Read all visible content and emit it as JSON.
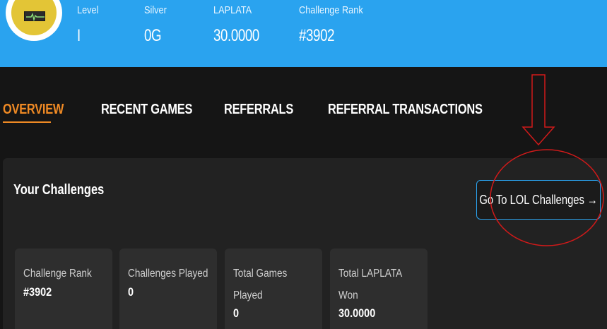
{
  "profile": {
    "avatar_icon": "robot-avatar-icon",
    "stats": [
      {
        "label": "Level",
        "value": "I"
      },
      {
        "label": "Silver",
        "value": "0G"
      },
      {
        "label": "LAPLATA",
        "value": "30.0000"
      },
      {
        "label": "Challenge Rank",
        "value": "#3902"
      }
    ]
  },
  "tabs": [
    {
      "label": "OVERVIEW",
      "active": true
    },
    {
      "label": "RECENT GAMES",
      "active": false
    },
    {
      "label": "REFERRALS",
      "active": false
    },
    {
      "label": "REFERRAL TRANSACTIONS",
      "active": false
    }
  ],
  "challenges": {
    "title": "Your Challenges",
    "goto_button": "Go To LOL Challenges →",
    "cards": [
      {
        "label_lines": [
          "Challenge Rank"
        ],
        "value": "#3902"
      },
      {
        "label_lines": [
          "Challenges Played"
        ],
        "value": "0"
      },
      {
        "label_lines": [
          "Total Games",
          "Played"
        ],
        "value": "0"
      },
      {
        "label_lines": [
          "Total LAPLATA",
          "Won"
        ],
        "value": "30.0000"
      }
    ]
  },
  "colors": {
    "header_bg": "#2aa3ef",
    "accent_orange": "#f08a24",
    "annotation_red": "#d11a1a",
    "page_bg": "#151515",
    "panel_bg": "#222222",
    "card_bg": "#2e2e2e"
  }
}
